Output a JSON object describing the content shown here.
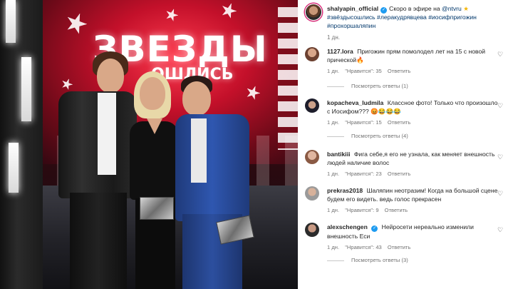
{
  "post": {
    "username": "shalyapin_official",
    "caption": "Скоро в эфире на ",
    "mention": "@ntvru",
    "hashtags": "#звёздысошлись #леракудрявцева #иосифпригожин #прохоршаляпин",
    "time": "1 дн."
  },
  "photo": {
    "title": "ЗВЕЗДЫ",
    "subtitle": "ОШЛИСЬ"
  },
  "comments": [
    {
      "username": "1127.lora",
      "text": "Пригожин прям помолодел лет на 15 с новой прической🔥",
      "time": "1 дн.",
      "likes": "\"Нравится\": 35",
      "reply": "Ответить",
      "view_replies": "Посмотреть ответы (1)"
    },
    {
      "username": "kopacheva_ludmila",
      "text": "Классное фото! Только что произошло с Иосифом??? 😡😂😂😂",
      "time": "1 дн.",
      "likes": "\"Нравится\": 15",
      "reply": "Ответить",
      "view_replies": "Посмотреть ответы (4)"
    },
    {
      "username": "bantikiii",
      "text": "Фига себе,я его не узнала, как меняет внешность людей наличие волос",
      "time": "1 дн.",
      "likes": "\"Нравится\": 23",
      "reply": "Ответить"
    },
    {
      "username": "prekras2018",
      "text": "Шаляпин неотразим! Когда на большой сцене будем его видеть. ведь голос прекрасен",
      "time": "1 дн.",
      "likes": "\"Нравится\": 9",
      "reply": "Ответить"
    },
    {
      "username": "alexschengen",
      "text": "Нейросети нереально изменили внешность Еси",
      "time": "1 дн.",
      "likes": "\"Нравится\": 43",
      "reply": "Ответить",
      "view_replies": "Посмотреть ответы (3)"
    }
  ],
  "icons": {
    "verified": "verified-badge-icon",
    "star": "star-emoji",
    "heart": "heart-outline-icon"
  },
  "colors": {
    "link": "#00376b",
    "meta": "#737373",
    "verified": "#1d9bf0",
    "stage_red": "#c3102a"
  }
}
